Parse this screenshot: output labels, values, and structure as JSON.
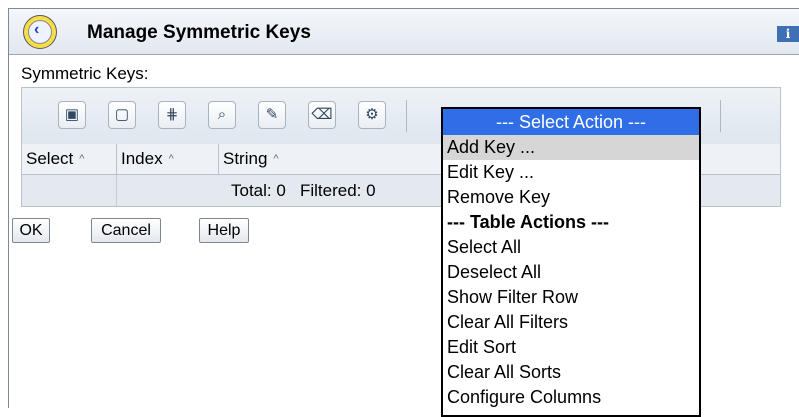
{
  "window": {
    "title": "Manage Symmetric Keys",
    "title_icon": "back-clock-icon",
    "info_icon_label": "i"
  },
  "section_label": "Symmetric Keys:",
  "toolbar": {
    "buttons": [
      {
        "name": "select-all-icon",
        "glyph": "▣"
      },
      {
        "name": "deselect-all-icon",
        "glyph": "▢"
      },
      {
        "name": "show-filter-icon",
        "glyph": "⋕"
      },
      {
        "name": "clear-filter-icon",
        "glyph": "⌕"
      },
      {
        "name": "edit-sort-icon",
        "glyph": "✎"
      },
      {
        "name": "clear-sort-icon",
        "glyph": "⌫"
      },
      {
        "name": "configure-columns-icon",
        "glyph": "⚙"
      }
    ]
  },
  "table": {
    "columns": [
      "Select",
      "Index",
      "String"
    ],
    "sort_indicator": "^",
    "total_label": "Total: 0",
    "filtered_label": "Filtered: 0"
  },
  "buttons": {
    "ok": "OK",
    "cancel": "Cancel",
    "help": "Help"
  },
  "action_menu": {
    "selected": "--- Select Action ---",
    "items": [
      {
        "label": "Add Key ...",
        "highlighted": true,
        "bold": false
      },
      {
        "label": "Edit Key ...",
        "highlighted": false,
        "bold": false
      },
      {
        "label": "Remove Key",
        "highlighted": false,
        "bold": false
      },
      {
        "label": "--- Table Actions ---",
        "highlighted": false,
        "bold": true
      },
      {
        "label": "Select All",
        "highlighted": false,
        "bold": false
      },
      {
        "label": "Deselect All",
        "highlighted": false,
        "bold": false
      },
      {
        "label": "Show Filter Row",
        "highlighted": false,
        "bold": false
      },
      {
        "label": "Clear All Filters",
        "highlighted": false,
        "bold": false
      },
      {
        "label": "Edit Sort",
        "highlighted": false,
        "bold": false
      },
      {
        "label": "Clear All Sorts",
        "highlighted": false,
        "bold": false
      },
      {
        "label": "Configure Columns",
        "highlighted": false,
        "bold": false
      }
    ]
  },
  "colors": {
    "dropdown_selected_bg": "#2f6ee6",
    "menu_highlight": "#d6d6d6"
  }
}
